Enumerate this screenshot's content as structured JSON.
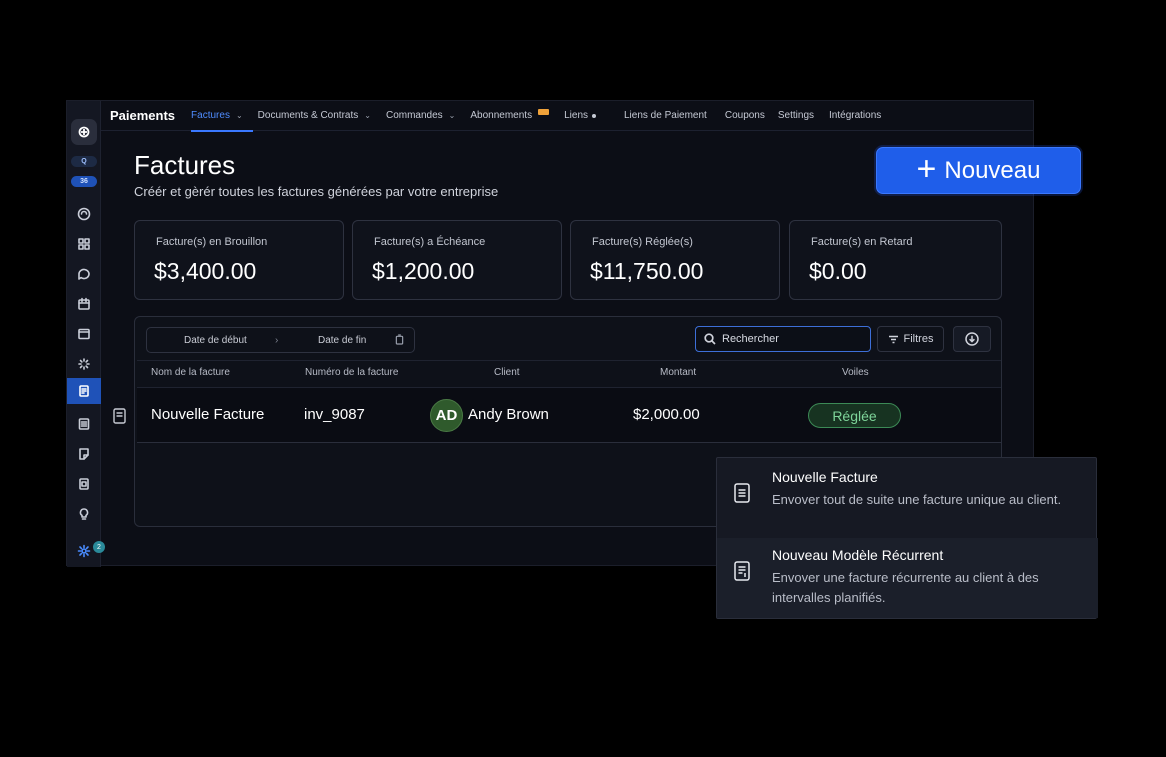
{
  "nav": {
    "brand": "Paiements",
    "items": [
      {
        "label": "Factures",
        "active": true,
        "chevron": true
      },
      {
        "label": "Documents & Contrats",
        "chevron": true
      },
      {
        "label": "Commandes",
        "chevron": true
      },
      {
        "label": "Abonnements",
        "tag": true
      },
      {
        "label": "Liens",
        "dot": true
      },
      {
        "label": "Liens de Paiement"
      },
      {
        "label": "Coupons"
      },
      {
        "label": "Settings"
      },
      {
        "label": "Intégrations"
      }
    ]
  },
  "rail": {
    "pill1": "Q",
    "pill2": "36",
    "badge": "2"
  },
  "page": {
    "title": "Factures",
    "subtitle": "Créér et gèrér toutes les factures générées par votre entreprise",
    "new_button": "Nouveau",
    "new_button_icon": "plus-icon"
  },
  "stats": [
    {
      "label": "Facture(s) en Brouillon",
      "value": "$3,400.00"
    },
    {
      "label": "Facture(s) a Échéance",
      "value": "$1,200.00"
    },
    {
      "label": "Facture(s) Réglée(s)",
      "value": "$11,750.00"
    },
    {
      "label": "Facture(s) en Retard",
      "value": "$0.00"
    }
  ],
  "toolbar": {
    "start_date": "Date de début",
    "end_date": "Date de fin",
    "search_value": "Rechercher",
    "filters": "Filtres"
  },
  "table": {
    "columns": [
      "Nom de la facture",
      "Numéro de la facture",
      "Client",
      "Montant",
      "Voiles"
    ],
    "rows": [
      {
        "name": "Nouvelle Facture",
        "number": "inv_9087",
        "initials": "AD",
        "client": "Andy Brown",
        "amount": "$2,000.00",
        "status": "Réglée"
      }
    ]
  },
  "dropdown": {
    "items": [
      {
        "title": "Nouvelle Facture",
        "desc": "Envover tout de suite une facture unique au client."
      },
      {
        "title": "Nouveau Modèle Récurrent",
        "desc": "Envover une facture récurrente au client à des intervalles planifiés."
      }
    ]
  },
  "colors": {
    "accent": "#1f5eea",
    "active_nav": "#4f8cff",
    "status_green": "#7fd59a",
    "tag_orange": "#f0a23a"
  }
}
